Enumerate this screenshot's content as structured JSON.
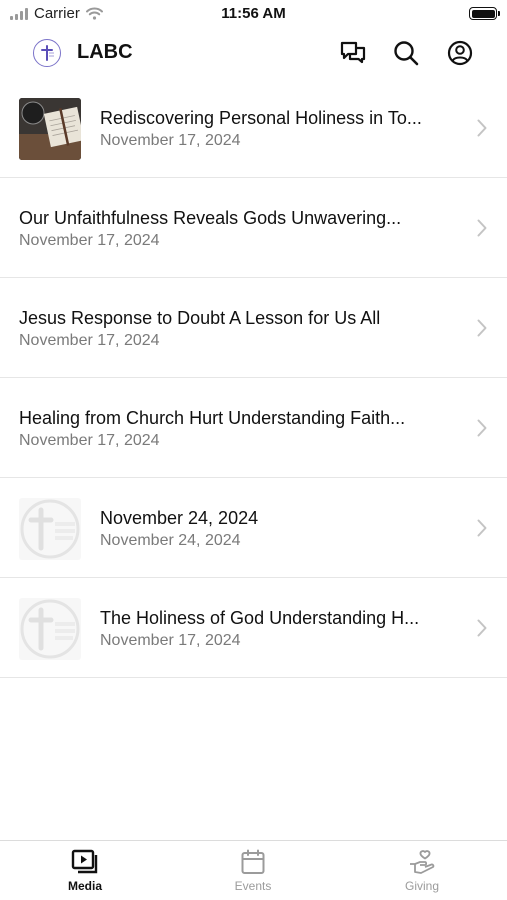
{
  "status_bar": {
    "carrier": "Carrier",
    "time": "11:56 AM"
  },
  "header": {
    "title": "LABC",
    "icons": [
      "chat-icon",
      "search-icon",
      "profile-icon"
    ]
  },
  "items": [
    {
      "title": "Rediscovering Personal Holiness in To...",
      "date": "November 17, 2024",
      "thumb": "photo"
    },
    {
      "title": "Our Unfaithfulness Reveals Gods Unwavering...",
      "date": "November 17, 2024",
      "thumb": "none"
    },
    {
      "title": "Jesus Response to Doubt A Lesson for Us All",
      "date": "November 17, 2024",
      "thumb": "none"
    },
    {
      "title": "Healing from Church Hurt Understanding Faith...",
      "date": "November 17, 2024",
      "thumb": "none"
    },
    {
      "title": "November 24, 2024",
      "date": "November 24, 2024",
      "thumb": "logo"
    },
    {
      "title": "The Holiness of God Understanding H...",
      "date": "November 17, 2024",
      "thumb": "logo"
    }
  ],
  "tabs": [
    {
      "label": "Media",
      "icon": "media-icon",
      "active": true
    },
    {
      "label": "Events",
      "icon": "calendar-icon",
      "active": false
    },
    {
      "label": "Giving",
      "icon": "giving-icon",
      "active": false
    }
  ]
}
